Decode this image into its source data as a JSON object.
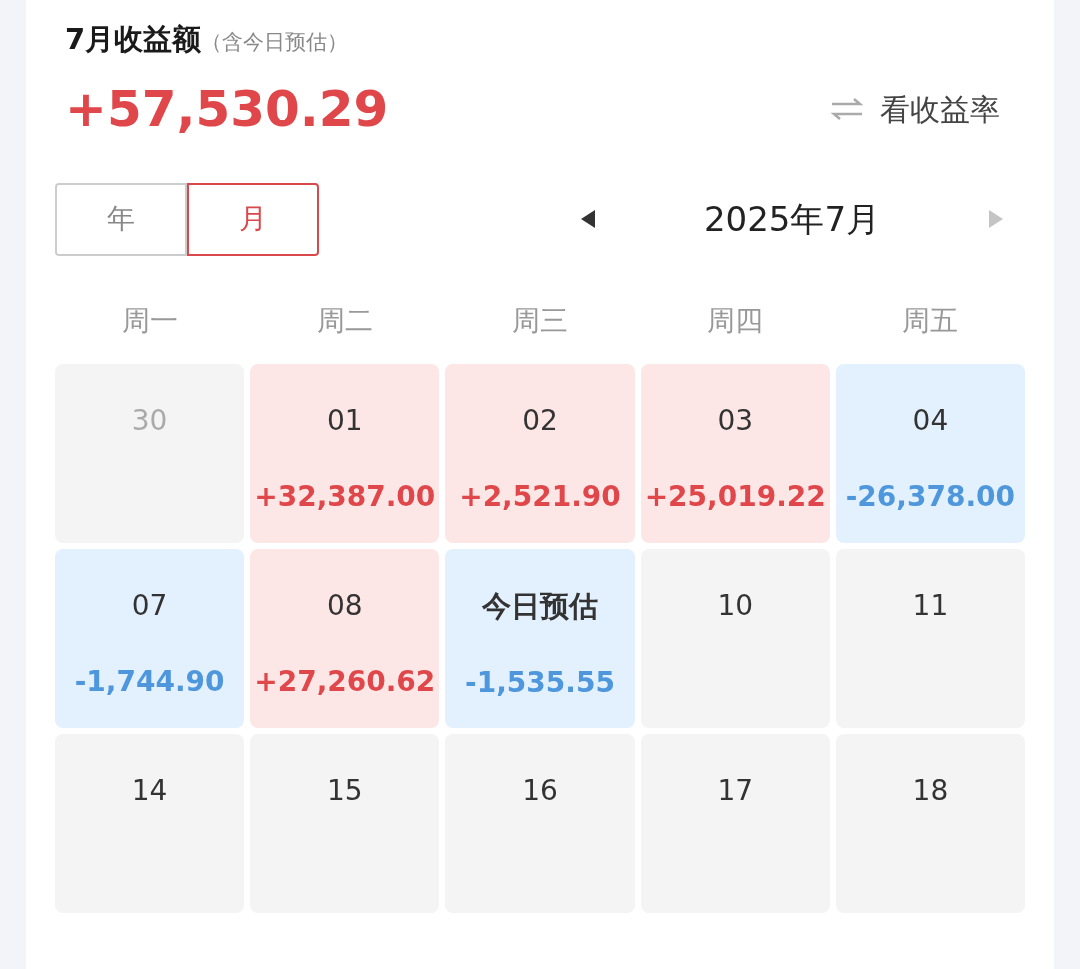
{
  "header": {
    "title": "7月收益额",
    "note": "（含今日预估）",
    "amount": "+57,530.29",
    "switch_label": "看收益率"
  },
  "period_tabs": [
    {
      "label": "年",
      "selected": false
    },
    {
      "label": "月",
      "selected": true
    }
  ],
  "month_nav": {
    "label": "2025年7月",
    "prev_disabled": false,
    "next_disabled": true
  },
  "weekdays": [
    "周一",
    "周二",
    "周三",
    "周四",
    "周五"
  ],
  "days": [
    {
      "label": "30",
      "kind": "outside",
      "today": false
    },
    {
      "label": "01",
      "kind": "gain",
      "value": "+32,387.00",
      "today": false
    },
    {
      "label": "02",
      "kind": "gain",
      "value": "+2,521.90",
      "today": false
    },
    {
      "label": "03",
      "kind": "gain",
      "value": "+25,019.22",
      "today": false
    },
    {
      "label": "04",
      "kind": "loss",
      "value": "-26,378.00",
      "today": false
    },
    {
      "label": "07",
      "kind": "loss",
      "value": "-1,744.90",
      "today": false
    },
    {
      "label": "08",
      "kind": "gain",
      "value": "+27,260.62",
      "today": false
    },
    {
      "label": "今日预估",
      "kind": "loss",
      "value": "-1,535.55",
      "today": true
    },
    {
      "label": "10",
      "kind": "plain",
      "today": false
    },
    {
      "label": "11",
      "kind": "plain",
      "today": false
    },
    {
      "label": "14",
      "kind": "plain",
      "today": false
    },
    {
      "label": "15",
      "kind": "plain",
      "today": false
    },
    {
      "label": "16",
      "kind": "plain",
      "today": false
    },
    {
      "label": "17",
      "kind": "plain",
      "today": false
    },
    {
      "label": "18",
      "kind": "plain",
      "today": false
    }
  ]
}
